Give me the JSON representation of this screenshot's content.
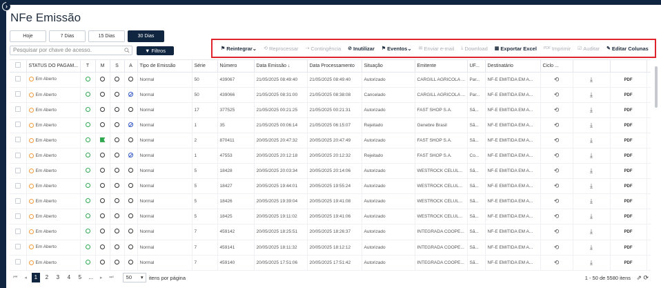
{
  "page": {
    "title": "NFe Emissão"
  },
  "periods": [
    "Hoje",
    "7 Dias",
    "15 Dias",
    "30 Dias"
  ],
  "active_period": "30 Dias",
  "search": {
    "placeholder": "Pesquisar por chave de acesso."
  },
  "filters_label": "Filtros",
  "toolbar": [
    {
      "label": "Reintegrar",
      "icon": "flag-icon",
      "enabled": true,
      "dropdown": true
    },
    {
      "label": "Reprocessar",
      "icon": "refresh-icon",
      "enabled": false
    },
    {
      "label": "Contingência",
      "icon": "arrow-icon",
      "enabled": false
    },
    {
      "label": "Inutilizar",
      "icon": "ban-icon",
      "enabled": true
    },
    {
      "label": "Eventos",
      "icon": "flag-icon",
      "enabled": true,
      "dropdown": true
    },
    {
      "label": "Enviar e-mail",
      "icon": "mail-icon",
      "enabled": false
    },
    {
      "label": "Download",
      "icon": "download-icon",
      "enabled": false
    },
    {
      "label": "Exportar Excel",
      "icon": "excel-icon",
      "enabled": true
    },
    {
      "label": "Imprimir",
      "icon": "pdf-icon",
      "enabled": false
    },
    {
      "label": "Auditar",
      "icon": "audit-icon",
      "enabled": false
    },
    {
      "label": "Editar Colunas",
      "icon": "edit-icon",
      "enabled": true
    }
  ],
  "columns": [
    "STATUS DO PAGAM...",
    "T",
    "M",
    "S",
    "A",
    "Tipo de Emissão",
    "Série",
    "Número",
    "Data Emissão",
    "Data Processamento",
    "Situação",
    "Emitente",
    "UF...",
    "Destinatário",
    "Ciclo ...",
    "",
    "",
    ""
  ],
  "rows": [
    {
      "status": "Em Aberto",
      "m": "circle",
      "a": "circle",
      "tipo": "Normal",
      "serie": "50",
      "numero": "439067",
      "emissao": "21/05/2025 08:49:40",
      "processamento": "21/05/2025 08:49:40",
      "situacao": "Autorizado",
      "emitente": "CARGILL AGRICOLA ...",
      "uf": "Par...",
      "destinatario": "NF-E EMITIDA EM A..."
    },
    {
      "status": "Em Aberto",
      "m": "circle",
      "a": "ban",
      "tipo": "Normal",
      "serie": "50",
      "numero": "439066",
      "emissao": "21/05/2025 08:31:00",
      "processamento": "21/05/2025 08:38:08",
      "situacao": "Cancelado",
      "emitente": "CARGILL AGRICOLA ...",
      "uf": "Par...",
      "destinatario": "NF-E EMITIDA EM A..."
    },
    {
      "status": "Em Aberto",
      "m": "circle",
      "a": "circle",
      "tipo": "Normal",
      "serie": "17",
      "numero": "377525",
      "emissao": "21/05/2025 00:21:25",
      "processamento": "21/05/2025 00:21:31",
      "situacao": "Autorizado",
      "emitente": "FAST SHOP S.A.",
      "uf": "Sã...",
      "destinatario": "NF-E EMITIDA EM A..."
    },
    {
      "status": "Em Aberto",
      "m": "circle",
      "a": "ban",
      "tipo": "Normal",
      "serie": "1",
      "numero": "35",
      "emissao": "21/05/2025 00:06:14",
      "processamento": "21/05/2025 06:15:07",
      "situacao": "Rejeitado",
      "emitente": "Genebre Brasil",
      "uf": "Sã...",
      "destinatario": "NF-E EMITIDA EM A..."
    },
    {
      "status": "Em Aberto",
      "m": "flag",
      "a": "circle",
      "tipo": "Normal",
      "serie": "2",
      "numero": "870411",
      "emissao": "20/05/2025 20:47:32",
      "processamento": "20/05/2025 20:47:49",
      "situacao": "Autorizado",
      "emitente": "FAST SHOP S.A.",
      "uf": "Sã...",
      "destinatario": "NF-E EMITIDA EM A..."
    },
    {
      "status": "Em Aberto",
      "m": "circle",
      "a": "ban",
      "tipo": "Normal",
      "serie": "1",
      "numero": "47553",
      "emissao": "20/05/2025 20:12:18",
      "processamento": "20/05/2025 20:12:32",
      "situacao": "Rejeitado",
      "emitente": "FAST SHOP S.A.",
      "uf": "Co...",
      "destinatario": "NF-E EMITIDA EM A..."
    },
    {
      "status": "Em Aberto",
      "m": "circle",
      "a": "circle",
      "tipo": "Normal",
      "serie": "5",
      "numero": "18428",
      "emissao": "20/05/2025 20:03:34",
      "processamento": "20/05/2025 20:14:06",
      "situacao": "Autorizado",
      "emitente": "WESTROCK CELUL...",
      "uf": "Sã...",
      "destinatario": "NF-E EMITIDA EM A..."
    },
    {
      "status": "Em Aberto",
      "m": "circle",
      "a": "circle",
      "tipo": "Normal",
      "serie": "5",
      "numero": "18427",
      "emissao": "20/05/2025 19:44:01",
      "processamento": "20/05/2025 19:55:24",
      "situacao": "Autorizado",
      "emitente": "WESTROCK CELUL...",
      "uf": "Sã...",
      "destinatario": "NF-E EMITIDA EM A..."
    },
    {
      "status": "Em Aberto",
      "m": "circle",
      "a": "circle",
      "tipo": "Normal",
      "serie": "5",
      "numero": "18426",
      "emissao": "20/05/2025 19:39:04",
      "processamento": "20/05/2025 19:41:08",
      "situacao": "Autorizado",
      "emitente": "WESTROCK CELUL...",
      "uf": "Sã...",
      "destinatario": "NF-E EMITIDA EM A..."
    },
    {
      "status": "Em Aberto",
      "m": "circle",
      "a": "circle",
      "tipo": "Normal",
      "serie": "5",
      "numero": "18425",
      "emissao": "20/05/2025 19:11:02",
      "processamento": "20/05/2025 19:41:06",
      "situacao": "Autorizado",
      "emitente": "WESTROCK CELUL...",
      "uf": "Sã...",
      "destinatario": "NF-E EMITIDA EM A..."
    },
    {
      "status": "Em Aberto",
      "m": "circle",
      "a": "circle",
      "tipo": "Normal",
      "serie": "7",
      "numero": "459142",
      "emissao": "20/05/2025 18:25:51",
      "processamento": "20/05/2025 18:26:37",
      "situacao": "Autorizado",
      "emitente": "INTEGRADA COOPE...",
      "uf": "Sã...",
      "destinatario": "NF-E EMITIDA EM A..."
    },
    {
      "status": "Em Aberto",
      "m": "circle",
      "a": "circle",
      "tipo": "Normal",
      "serie": "7",
      "numero": "459141",
      "emissao": "20/05/2025 18:11:32",
      "processamento": "20/05/2025 18:12:12",
      "situacao": "Autorizado",
      "emitente": "INTEGRADA COOPE...",
      "uf": "Sã...",
      "destinatario": "NF-E EMITIDA EM A..."
    },
    {
      "status": "Em Aberto",
      "m": "circle",
      "a": "circle",
      "tipo": "Normal",
      "serie": "7",
      "numero": "459140",
      "emissao": "20/05/2025 17:51:06",
      "processamento": "20/05/2025 17:51:42",
      "situacao": "Autorizado",
      "emitente": "INTEGRADA COOPE...",
      "uf": "Sã...",
      "destinatario": "NF-E EMITIDA EM A..."
    }
  ],
  "pager": {
    "pages": [
      "1",
      "2",
      "3",
      "4",
      "5",
      "..."
    ],
    "active_page": "1",
    "page_size": "50",
    "per_page_label": "itens por página",
    "info": "1 - 50 de 5580 itens"
  },
  "colors": {
    "navy": "#0f2540",
    "highlight": "#e0222a",
    "pending": "#f29a3c",
    "ok": "#2fa84f",
    "cancel": "#3358c4"
  }
}
